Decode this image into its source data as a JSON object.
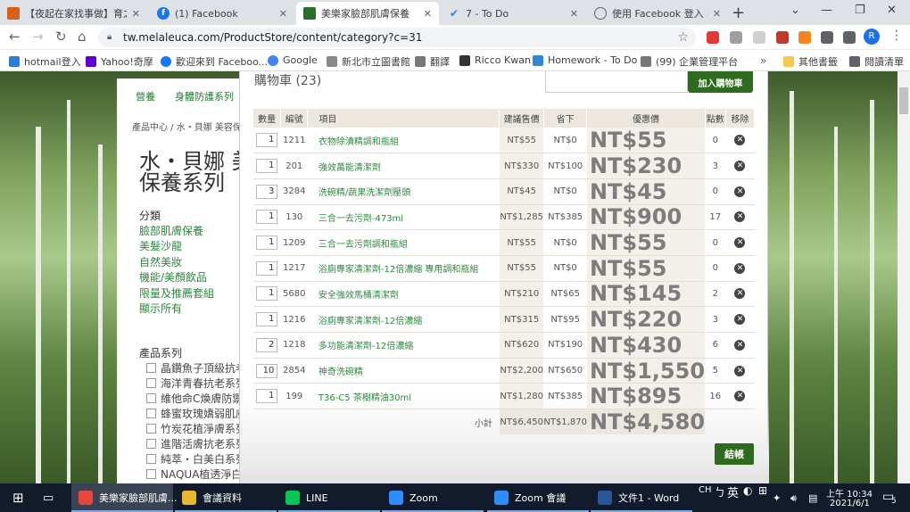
{
  "tabs": [
    {
      "title": "【夜起在家找事做】育之",
      "icon": "page-icon",
      "color": "#d95f1a"
    },
    {
      "title": "(1) Facebook",
      "icon": "facebook-icon",
      "color": "#1877f2"
    },
    {
      "title": "美樂家臉部肌膚保養",
      "icon": "melaleuca-icon",
      "color": "#2b6e2b"
    },
    {
      "title": "7 - To Do",
      "icon": "todo-check-icon",
      "color": "#2b88d8"
    },
    {
      "title": "使用 Facebook 登入 - Zo",
      "icon": "globe-icon",
      "color": "#5f6368"
    }
  ],
  "browser": {
    "url": "tw.melaleuca.com/ProductStore/content/category?c=31",
    "profile_initial": "R"
  },
  "bookmarks": [
    "hotmail登入",
    "Yahoo!奇摩",
    "歡迎來到 Faceboo...",
    "Google",
    "新北市立圖書館",
    "翻譯",
    "Ricco Kwan",
    "Homework - To Do",
    "(99) 企業管理平台",
    "其他書籤",
    "閱讀清單"
  ],
  "site": {
    "top_nav": [
      "營養",
      "身體防護系列"
    ],
    "breadcrumb": "產品中心 / 水・貝娜 美容保",
    "page_title_line1": "水・貝娜 美",
    "page_title_line2": "保養系列",
    "category_heading": "分類",
    "categories": [
      "臉部肌膚保養",
      "美髮沙龍",
      "自然美妝",
      "機能/美顏飲品",
      "限量及推薦套組",
      "顯示所有"
    ],
    "series_heading": "產品系列",
    "series": [
      "晶鑽魚子頂級抗老",
      "海洋青春抗老系列",
      "維他命C煥膚防禦",
      "蜂蜜玫瑰嬌弱肌膚",
      "竹炭花植淨膚系列",
      "進階活膚抗老系列",
      "純萃・白美白系列",
      "NAQUA植透淨白系"
    ]
  },
  "cart": {
    "title": "購物車 (23)",
    "add_button": "加入購物車",
    "columns": [
      "數量",
      "編號",
      "項目",
      "建議售價",
      "省下",
      "優惠價",
      "點數",
      "移除"
    ],
    "items": [
      {
        "qty": "1",
        "code": "1211",
        "name": "衣物除漬精調和瓶組",
        "list": "NT$55",
        "save": "NT$0",
        "price": "NT$55",
        "points": "0"
      },
      {
        "qty": "1",
        "code": "201",
        "name": "強效萬能清潔劑",
        "list": "NT$330",
        "save": "NT$100",
        "price": "NT$230",
        "points": "3"
      },
      {
        "qty": "3",
        "code": "3284",
        "name": "洗碗精/蔬果洗潔劑壓頭",
        "list": "NT$45",
        "save": "NT$0",
        "price": "NT$45",
        "points": "0"
      },
      {
        "qty": "1",
        "code": "130",
        "name": "三合一去污劑-473ml",
        "list": "NT$1,285",
        "save": "NT$385",
        "price": "NT$900",
        "points": "17"
      },
      {
        "qty": "1",
        "code": "1209",
        "name": "三合一去污劑調和瓶組",
        "list": "NT$55",
        "save": "NT$0",
        "price": "NT$55",
        "points": "0"
      },
      {
        "qty": "1",
        "code": "1217",
        "name": "浴廁專家清潔劑-12倍濃縮 專用調和瓶組",
        "list": "NT$55",
        "save": "NT$0",
        "price": "NT$55",
        "points": "0"
      },
      {
        "qty": "1",
        "code": "5680",
        "name": "安全強效馬桶清潔劑",
        "list": "NT$210",
        "save": "NT$65",
        "price": "NT$145",
        "points": "2"
      },
      {
        "qty": "1",
        "code": "1216",
        "name": "浴廁專家清潔劑-12倍濃縮",
        "list": "NT$315",
        "save": "NT$95",
        "price": "NT$220",
        "points": "3"
      },
      {
        "qty": "2",
        "code": "1218",
        "name": "多功能清潔劑-12倍濃縮",
        "list": "NT$620",
        "save": "NT$190",
        "price": "NT$430",
        "points": "6"
      },
      {
        "qty": "10",
        "code": "2854",
        "name": "神奇洗碗精",
        "list": "NT$2,200",
        "save": "NT$650",
        "price": "NT$1,550",
        "points": "5"
      },
      {
        "qty": "1",
        "code": "199",
        "name": "T36-C5 茶樹精油30ml",
        "list": "NT$1,280",
        "save": "NT$385",
        "price": "NT$895",
        "points": "16"
      }
    ],
    "subtotal": {
      "label": "小計",
      "list": "NT$6,450",
      "save": "NT$1,870",
      "price": "NT$4,580"
    },
    "checkout_button": "結帳"
  },
  "taskbar": {
    "apps": [
      {
        "label": "美樂家臉部肌膚...",
        "icon": "chrome-icon",
        "color": "#e8453c"
      },
      {
        "label": "會議資料",
        "icon": "folder-icon",
        "color": "#e8b930"
      },
      {
        "label": "LINE",
        "icon": "line-icon",
        "color": "#06c755"
      },
      {
        "label": "Zoom",
        "icon": "zoom-icon",
        "color": "#2d8cff"
      },
      {
        "label": "Zoom 會議",
        "icon": "zoom-icon",
        "color": "#2d8cff"
      },
      {
        "label": "文件1 - Word",
        "icon": "word-icon",
        "color": "#2b579a"
      }
    ],
    "ime_mode": "CH",
    "ime_lang": "英",
    "time": "上午 10:34",
    "date": "2021/6/1",
    "notifications": "5"
  }
}
